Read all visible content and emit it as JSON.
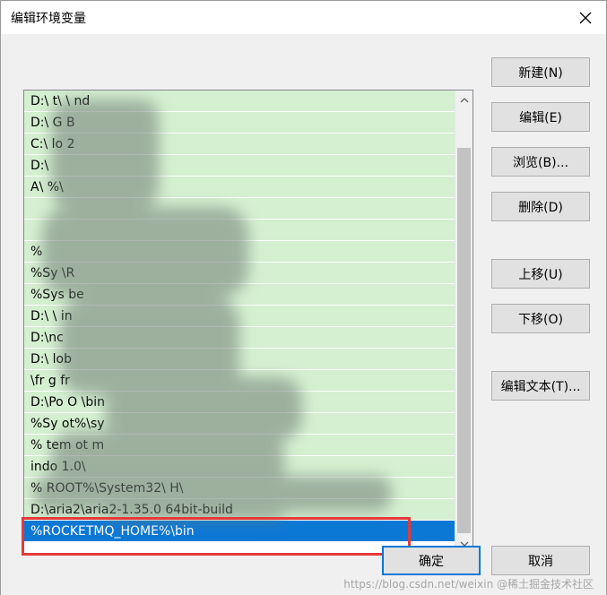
{
  "window": {
    "title": "编辑环境变量",
    "close_icon": "close-icon"
  },
  "path_list": {
    "rows": [
      "D:\\   t\\   \\   nd",
      "D:\\   G   B",
      "C:\\   lo         2",
      "D:\\",
      "    A\\         %\\",
      "",
      "",
      "%",
      "%Sy   \\R",
      "%Sys               be",
      "D:\\   \\                   in",
      "D:\\nc",
      "D:\\              lob",
      "   \\fr    g   fr",
      "D:\\Po       O         \\bin",
      "%Sy      ot%\\sy",
      "%   tem   ot          m",
      "                      indo         1.0\\",
      "%      ROOT%\\System32\\    H\\",
      "D:\\aria2\\aria2-1.35.0    64bit-build",
      "%ROCKETMQ_HOME%\\bin"
    ],
    "selected_index": 20
  },
  "buttons": {
    "new": "新建(N)",
    "edit": "编辑(E)",
    "browse": "浏览(B)...",
    "delete": "删除(D)",
    "move_up": "上移(U)",
    "move_down": "下移(O)",
    "edit_text": "编辑文本(T)...",
    "ok": "确定",
    "cancel": "取消"
  },
  "watermark": "https://blog.csdn.net/weixin    @稀土掘金技术社区",
  "colors": {
    "selected_row": "#0c78d5",
    "row_bg": "#d5efd1",
    "highlight_box": "#e43a3a",
    "primary_border": "#0078d7"
  }
}
